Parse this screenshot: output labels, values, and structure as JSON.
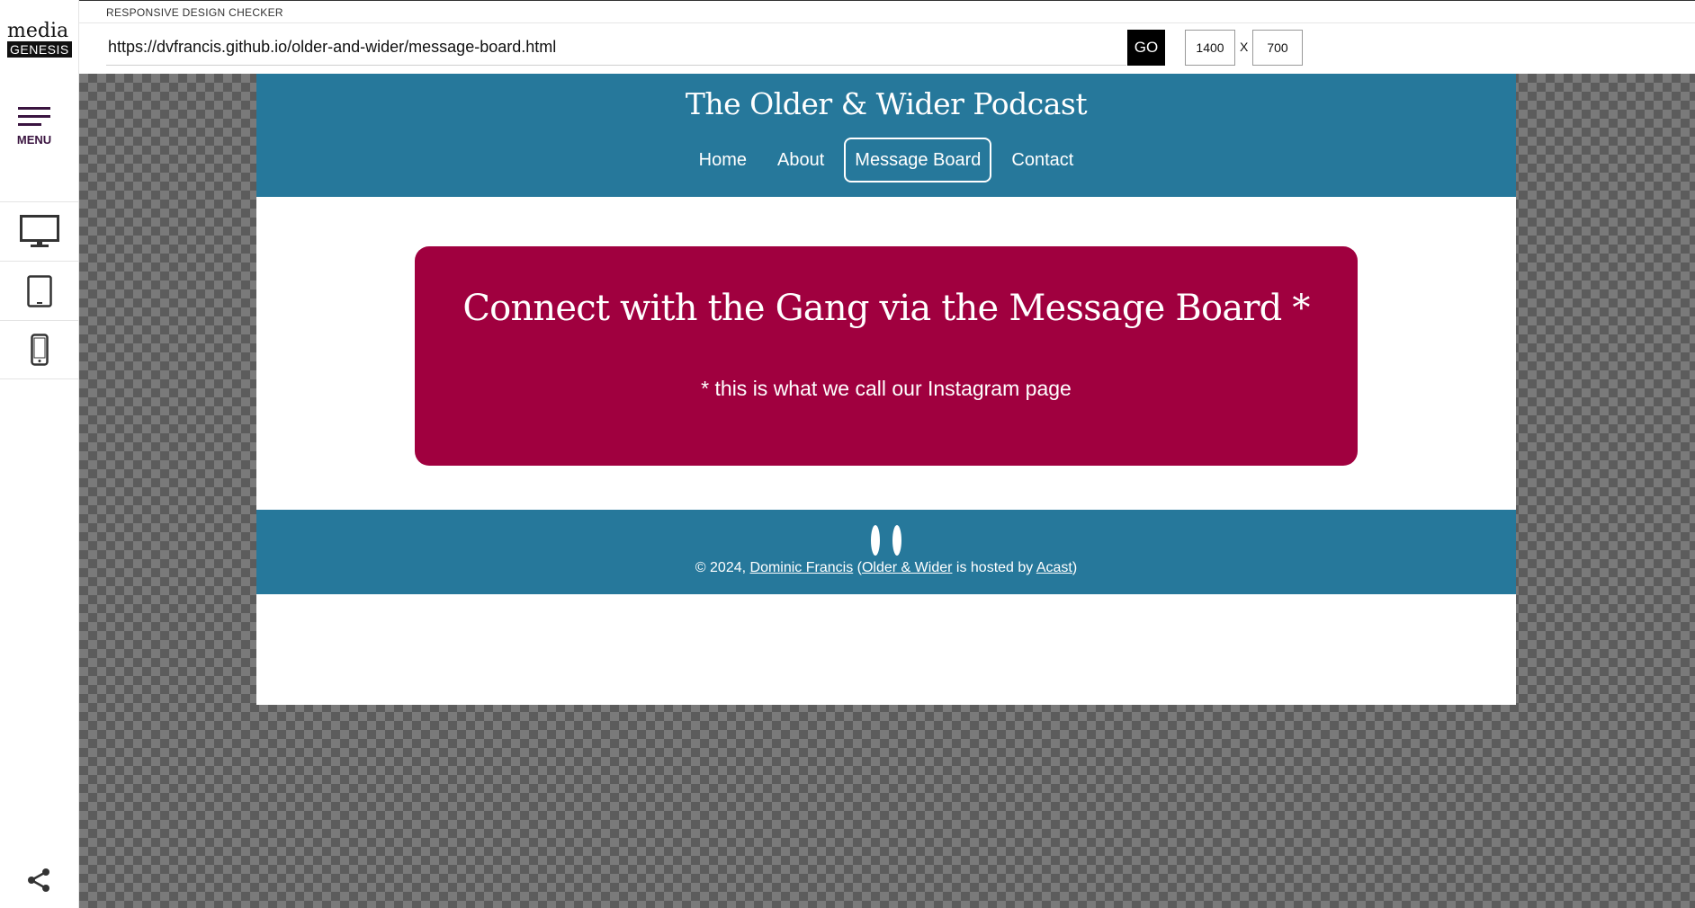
{
  "sidebar": {
    "logo_top": "media",
    "logo_bottom": "GENESIS",
    "menu_label": "MENU",
    "devices": [
      "desktop-icon",
      "tablet-icon",
      "mobile-icon"
    ],
    "share_icon": "share-icon"
  },
  "toolbar": {
    "app_label": "RESPONSIVE DESIGN CHECKER",
    "url": "https://dvfrancis.github.io/older-and-wider/message-board.html",
    "go_label": "GO",
    "width_value": "1400",
    "height_value": "700",
    "separator": "X"
  },
  "site": {
    "title": "The Older & Wider Podcast",
    "nav": [
      "Home",
      "About",
      "Message Board",
      "Contact"
    ],
    "active_nav": "Message Board",
    "card_title": "Connect with the Gang via the Message Board *",
    "card_subtitle": "* this is what we call our Instagram page",
    "footer": {
      "copyright": "© 2024, ",
      "author_link": "Dominic Francis",
      "open_paren": " (",
      "show_link": "Older & Wider",
      "hosted_text": " is hosted by ",
      "host_link": "Acast",
      "close_paren": ")"
    },
    "colors": {
      "header_bg": "#26789b",
      "card_bg": "#a0003f",
      "footer_bg": "#26789b"
    }
  }
}
